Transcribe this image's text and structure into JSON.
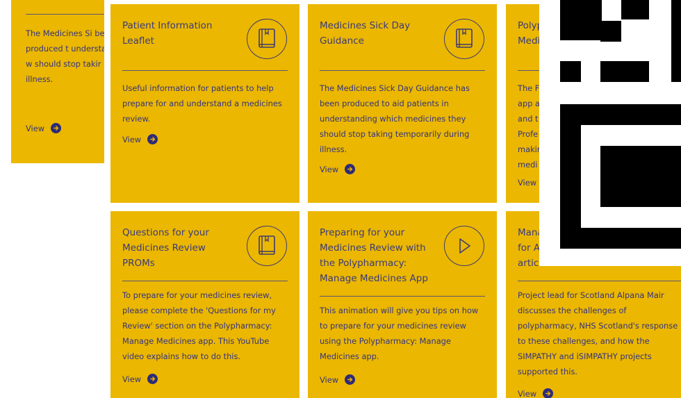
{
  "cards": [
    {
      "title": "",
      "description": "The Medicines Si been produced t understanding w should stop takir illness.",
      "view_label": "View"
    },
    {
      "title": "Patient Information Leaflet",
      "description": "Useful information for patients to help prepare for and understand a medicines review.",
      "view_label": "View",
      "icon": "book-icon"
    },
    {
      "title": "Medicines Sick Day Guidance",
      "description": "The Medicines Sick Day Guidance has been produced to aid patients in understanding which medicines they should stop taking temporarily during illness.",
      "view_label": "View",
      "icon": "book-icon"
    },
    {
      "title": "Polyp Medi",
      "description": "The F app a and t Profe makir medi",
      "view_label": "View"
    },
    {
      "title": "Questions for your Medicines Review PROMs",
      "description": "To prepare for your medicines review, please complete the 'Questions for my Review' section on the Polypharmacy: Manage Medicines app. This YouTube video explains how to do this.",
      "view_label": "View",
      "icon": "book-icon"
    },
    {
      "title": "Preparing for your Medicines Review with the Polypharmacy: Manage Medicines App",
      "description": "This animation will give you tips on how to prepare for your medicines review using the Polypharmacy: Manage Medicines app.",
      "view_label": "View",
      "icon": "play-icon"
    },
    {
      "title": "Mana for A artic",
      "description": "Project lead for Scotland Alpana Mair discusses the challenges of polypharmacy, NHS Scotland's response to these challenges, and how the SIMPATHY and iSIMPATHY projects supported this.",
      "view_label": "View"
    }
  ],
  "colors": {
    "card_background": "#ebb700",
    "text": "#33337a",
    "arrow": "#2e2b7a"
  }
}
